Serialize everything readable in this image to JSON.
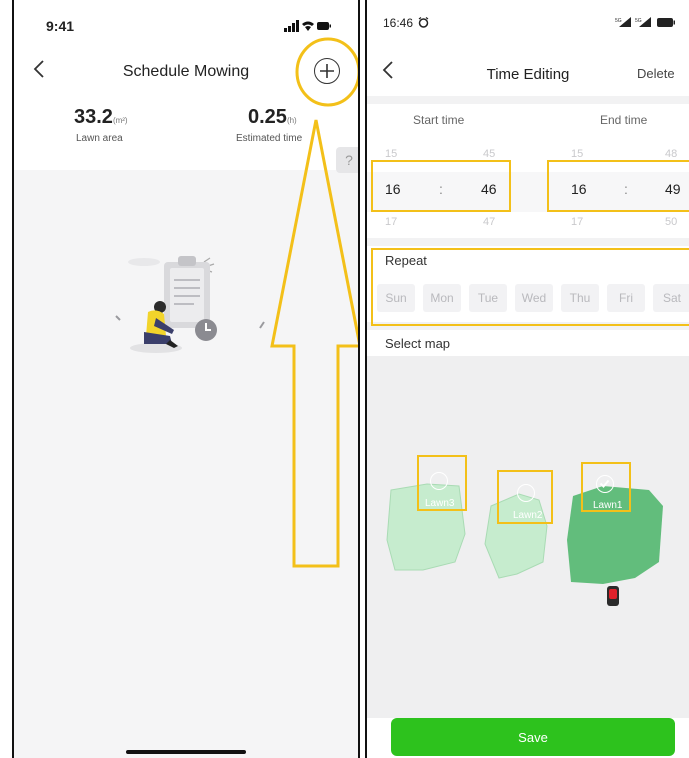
{
  "left_screen": {
    "status_time": "9:41",
    "title": "Schedule Mowing",
    "stats": [
      {
        "value": "33.2",
        "unit": "(m²)",
        "label": "Lawn area"
      },
      {
        "value": "0.25",
        "unit": "(h)",
        "label": "Estimated time"
      }
    ],
    "help_label": "?",
    "icons": {
      "back": "back-arrow-icon",
      "add": "add-circle-icon",
      "illustration": "empty-schedule-illustration"
    },
    "annotation_color": "#f3c019"
  },
  "right_screen": {
    "status_time": "16:46",
    "title": "Time Editing",
    "delete_label": "Delete",
    "start_label": "Start time",
    "end_label": "End time",
    "start_wheel": {
      "prev_hour": "15",
      "prev_min": "45",
      "hour": "16",
      "min": "46",
      "next_hour": "17",
      "next_min": "47"
    },
    "end_wheel": {
      "prev_hour": "15",
      "prev_min": "48",
      "hour": "16",
      "min": "49",
      "next_hour": "17",
      "next_min": "50"
    },
    "separator": ":",
    "repeat_label": "Repeat",
    "days": [
      "Sun",
      "Mon",
      "Tue",
      "Wed",
      "Thu",
      "Fri",
      "Sat"
    ],
    "select_map_label": "Select map",
    "lawns": [
      {
        "name": "Lawn3",
        "selected": false
      },
      {
        "name": "Lawn2",
        "selected": false
      },
      {
        "name": "Lawn1",
        "selected": true
      }
    ],
    "save_label": "Save",
    "colors": {
      "save": "#2dc21d",
      "lawn_selected": "#62bd7c",
      "lawn_unselected": "#c6ecce"
    }
  }
}
